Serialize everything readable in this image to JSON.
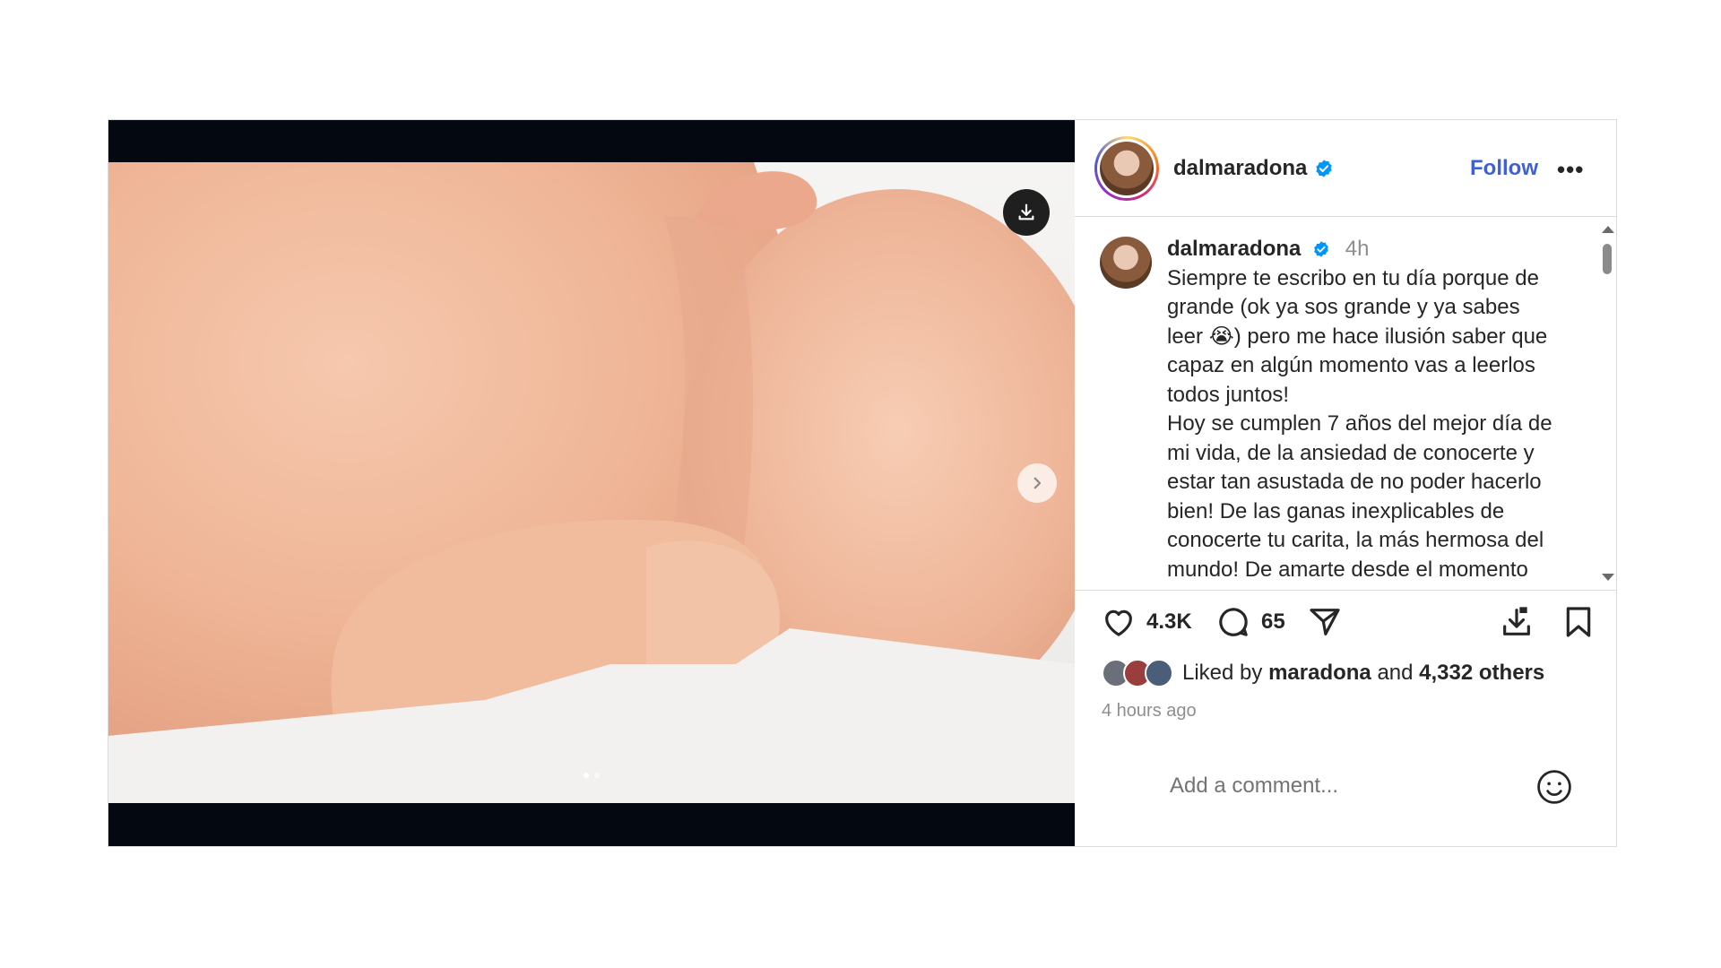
{
  "post": {
    "username": "dalmaradona",
    "follow_label": "Follow",
    "more_label": "•••",
    "caption": {
      "username": "dalmaradona",
      "time": "4h",
      "lines": [
        "Siempre te escribo en tu día porque de",
        "grande (ok ya sos grande y ya sabes",
        "leer 😭) pero me hace ilusión saber que",
        "capaz en algún momento vas a leerlos",
        "todos juntos!",
        "Hoy se cumplen 7 años del mejor día de",
        "mi vida, de la ansiedad de conocerte y",
        "estar tan asustada de no poder hacerlo",
        "bien! De las ganas inexplicables de",
        "conocerte tu carita, la más hermosa del",
        "mundo! De amarte desde el momento"
      ]
    },
    "likes_count": "4.3K",
    "comments_count": "65",
    "liked_by_prefix": "Liked by",
    "liked_by_user": "maradona",
    "liked_by_and": "and",
    "liked_by_others": "4,332 others",
    "time_ago": "4 hours ago",
    "comment_placeholder": "Add a comment..."
  },
  "icons": {
    "verified": "verified-badge-icon",
    "download": "download-icon",
    "next": "chevron-right-icon",
    "like": "heart-icon",
    "comment": "comment-bubble-icon",
    "share": "send-icon",
    "save_media": "download-icon",
    "bookmark": "bookmark-icon",
    "emoji": "smiley-icon"
  },
  "colors": {
    "accent": "#3f5fd6",
    "verified": "#0095f6",
    "muted": "#8e8e8e",
    "border": "#dbdbdb",
    "media_bg": "#040911"
  }
}
